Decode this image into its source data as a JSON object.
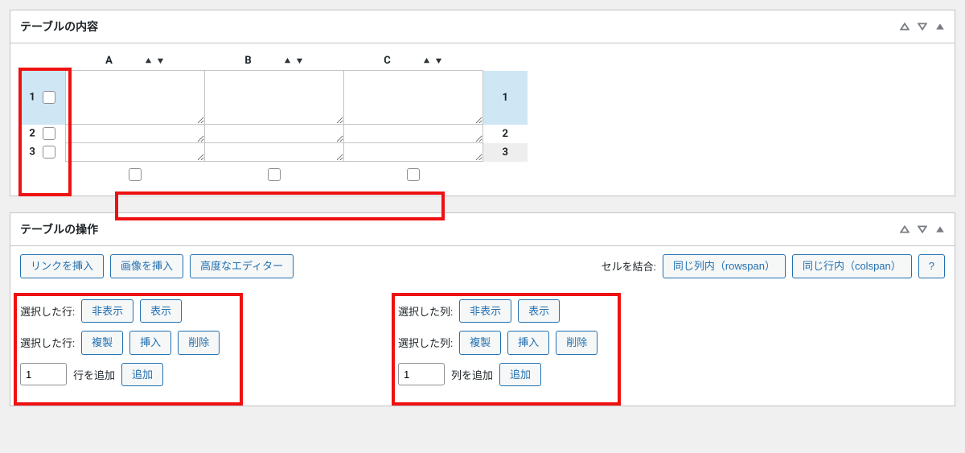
{
  "panel_content": {
    "title": "テーブルの内容",
    "columns": [
      "A",
      "B",
      "C"
    ],
    "rows": [
      "1",
      "2",
      "3"
    ],
    "cells": {
      "r1": [
        "",
        "",
        ""
      ],
      "r2": [
        "",
        "",
        ""
      ],
      "r3": [
        "",
        "",
        ""
      ]
    }
  },
  "panel_ops": {
    "title": "テーブルの操作",
    "insert_link": "リンクを挿入",
    "insert_image": "画像を挿入",
    "advanced_editor": "高度なエディター",
    "merge_label": "セルを結合:",
    "rowspan_btn": "同じ列内（rowspan）",
    "colspan_btn": "同じ行内（colspan）",
    "help_btn": "?",
    "rows_section": {
      "selected_label": "選択した行:",
      "hide": "非表示",
      "show": "表示",
      "duplicate": "複製",
      "insert": "挿入",
      "delete": "削除",
      "add_count": "1",
      "add_label": "行を追加",
      "add_btn": "追加"
    },
    "cols_section": {
      "selected_label": "選択した列:",
      "hide": "非表示",
      "show": "表示",
      "duplicate": "複製",
      "insert": "挿入",
      "delete": "削除",
      "add_count": "1",
      "add_label": "列を追加",
      "add_btn": "追加"
    }
  }
}
